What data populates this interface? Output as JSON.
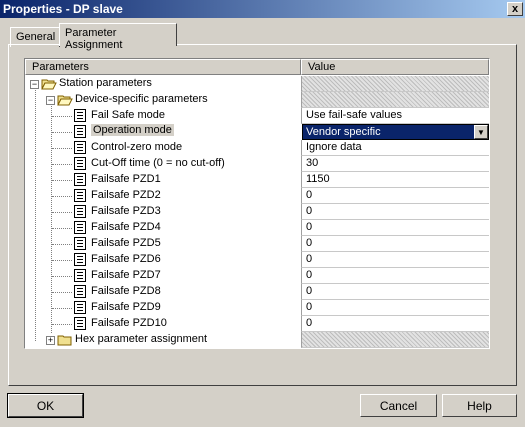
{
  "window": {
    "title": "Properties - DP slave",
    "close_label": "x"
  },
  "tabs": [
    {
      "label": "General"
    },
    {
      "label": "Parameter Assignment"
    }
  ],
  "grid": {
    "col_params": "Parameters",
    "col_value": "Value",
    "station": "Station parameters",
    "device": "Device-specific parameters",
    "params": [
      {
        "label": "Fail Safe mode",
        "value": "Use fail-safe values"
      },
      {
        "label": "Operation mode",
        "value": "Vendor specific"
      },
      {
        "label": "Control-zero mode",
        "value": "Ignore data"
      },
      {
        "label": "Cut-Off time (0 = no cut-off)",
        "value": "30"
      },
      {
        "label": "Failsafe PZD1",
        "value": "1150"
      },
      {
        "label": "Failsafe PZD2",
        "value": "0"
      },
      {
        "label": "Failsafe PZD3",
        "value": "0"
      },
      {
        "label": "Failsafe PZD4",
        "value": "0"
      },
      {
        "label": "Failsafe PZD5",
        "value": "0"
      },
      {
        "label": "Failsafe PZD6",
        "value": "0"
      },
      {
        "label": "Failsafe PZD7",
        "value": "0"
      },
      {
        "label": "Failsafe PZD8",
        "value": "0"
      },
      {
        "label": "Failsafe PZD9",
        "value": "0"
      },
      {
        "label": "Failsafe PZD10",
        "value": "0"
      }
    ],
    "hex": "Hex parameter assignment"
  },
  "buttons": {
    "ok": "OK",
    "cancel": "Cancel",
    "help": "Help"
  },
  "colors": {
    "selection": "#0a246a",
    "face": "#d4d0c8",
    "title_start": "#0a246a"
  }
}
